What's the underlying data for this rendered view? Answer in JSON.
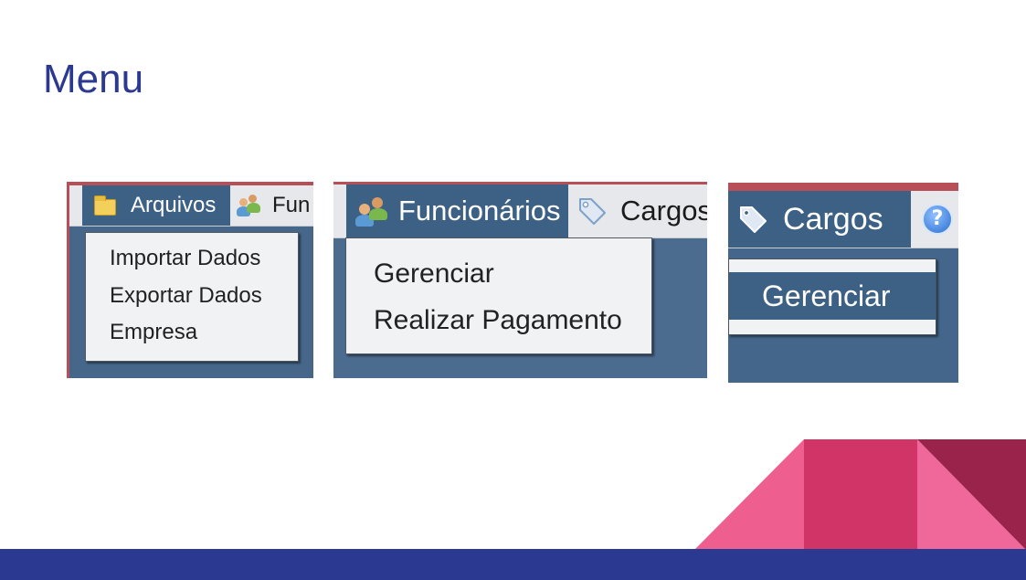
{
  "slide": {
    "title": "Menu"
  },
  "colors": {
    "title": "#2b3990",
    "bottom_bar": "#2b3990",
    "menu_active": "#3d6185",
    "app_background": "#46678a",
    "triangle_left": "#ee5f8f",
    "block_middle": "#d13567",
    "block_right": "#f0679a",
    "triangle_dark": "#9a234c"
  },
  "panels": [
    {
      "menubar": [
        {
          "label": "Arquivos",
          "icon": "folder-icon",
          "active": true
        },
        {
          "label": "Fun",
          "icon": "people-icon",
          "active": false
        }
      ],
      "dropdown": [
        "Importar Dados",
        "Exportar Dados",
        "Empresa"
      ]
    },
    {
      "menubar": [
        {
          "label": "Funcionários",
          "icon": "people-icon",
          "active": true
        },
        {
          "label": "Cargos",
          "icon": "tag-icon",
          "active": false
        }
      ],
      "dropdown": [
        "Gerenciar",
        "Realizar Pagamento"
      ]
    },
    {
      "menubar": [
        {
          "label": "Cargos",
          "icon": "tag-icon",
          "active": true
        },
        {
          "label": "?",
          "icon": "help-icon",
          "active": false
        }
      ],
      "dropdown": [
        "Gerenciar"
      ],
      "selected_item": "Gerenciar"
    }
  ]
}
